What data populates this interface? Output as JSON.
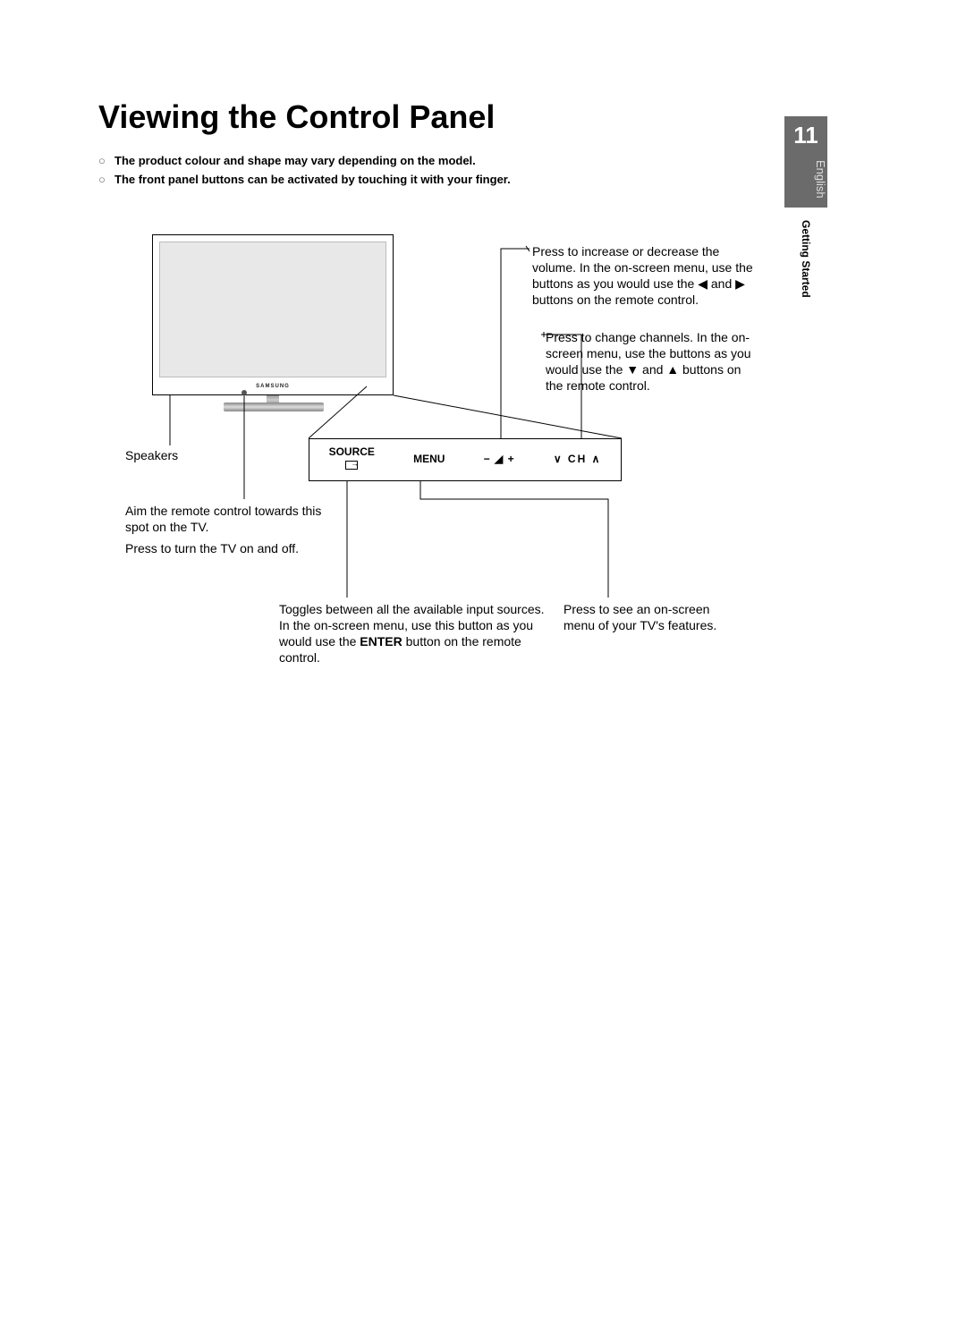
{
  "page": {
    "title": "Viewing the Control Panel",
    "notes": [
      "The product colour and shape may vary depending on the model.",
      "The front panel buttons can be activated by touching it with your finger."
    ]
  },
  "side_tab": {
    "page_number": "11",
    "language": "English",
    "section": "Getting Started"
  },
  "diagram": {
    "tv_brand": "SAMSUNG",
    "panel_buttons": {
      "source_label": "SOURCE",
      "menu_label": "MENU",
      "volume_label": "−  ◢  +",
      "channel_label": "∨ CH ∧"
    },
    "callouts": {
      "volume": "Press to increase or decrease the volume. In the on-screen menu, use the            buttons as you would use the ◀ and ▶ buttons on the remote control.",
      "channel": "Press to change channels. In the on-screen menu, use the            buttons as you would use the ▼ and ▲ buttons on the remote control.",
      "speakers": "Speakers",
      "remote_sensor_line1": "Aim the remote control towards this spot on the TV.",
      "remote_sensor_line2": "Press to turn the TV on and off.",
      "source_line1": "Toggles between all the available input sources.",
      "source_line2_a": "In the on-screen menu, use this button as you would use the ",
      "source_line2_bold": "ENTER",
      "source_line2_b": "     button on the remote control.",
      "menu": "Press to see an on-screen menu of your TV's features."
    }
  }
}
